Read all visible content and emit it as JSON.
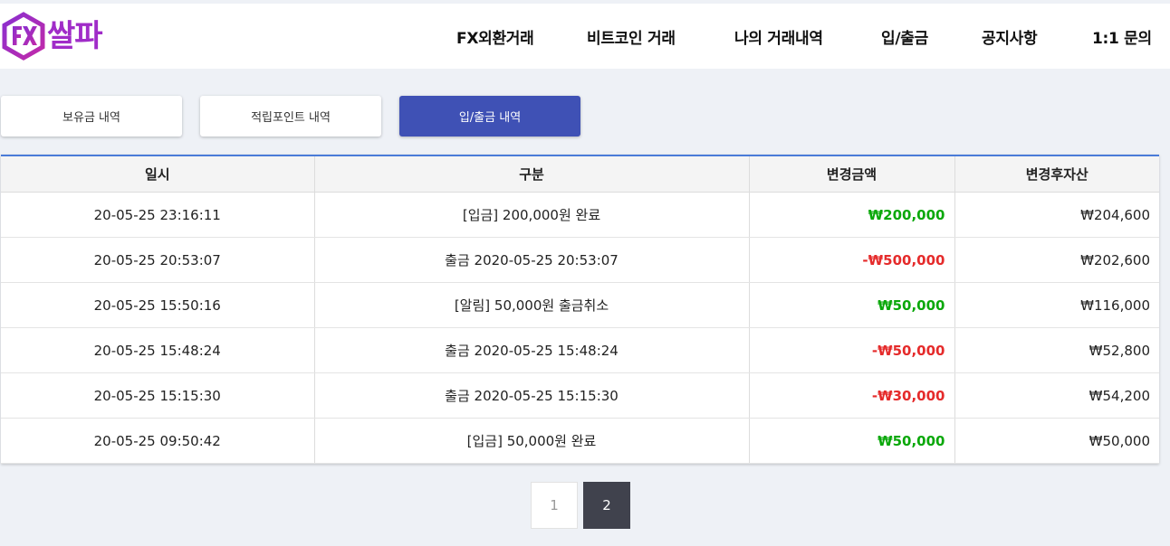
{
  "brand": {
    "logo_text": "쌀파",
    "accent": "#a02cc8"
  },
  "nav": [
    {
      "id": "fx",
      "label": "FX외환거래"
    },
    {
      "id": "bitcoin",
      "label": "비트코인 거래"
    },
    {
      "id": "history",
      "label": "나의 거래내역"
    },
    {
      "id": "deposit",
      "label": "입/출금"
    },
    {
      "id": "notice",
      "label": "공지사항"
    },
    {
      "id": "inquiry",
      "label": "1:1 문의"
    }
  ],
  "tabs": [
    {
      "label": "보유금 내역",
      "active": false
    },
    {
      "label": "적립포인트 내역",
      "active": false
    },
    {
      "label": "입/출금 내역",
      "active": true
    }
  ],
  "table": {
    "headers": [
      "일시",
      "구분",
      "변경금액",
      "변경후자산"
    ],
    "rows": [
      {
        "date": "20-05-25 23:16:11",
        "desc": "[입금] 200,000원 완료",
        "change": "₩200,000",
        "sign": "pos",
        "balance": "₩204,600"
      },
      {
        "date": "20-05-25 20:53:07",
        "desc": "출금 2020-05-25 20:53:07",
        "change": "-₩500,000",
        "sign": "neg",
        "balance": "₩202,600"
      },
      {
        "date": "20-05-25 15:50:16",
        "desc": "[알림] 50,000원 출금취소",
        "change": "₩50,000",
        "sign": "pos",
        "balance": "₩116,000"
      },
      {
        "date": "20-05-25 15:48:24",
        "desc": "출금 2020-05-25 15:48:24",
        "change": "-₩50,000",
        "sign": "neg",
        "balance": "₩52,800"
      },
      {
        "date": "20-05-25 15:15:30",
        "desc": "출금 2020-05-25 15:15:30",
        "change": "-₩30,000",
        "sign": "neg",
        "balance": "₩54,200"
      },
      {
        "date": "20-05-25 09:50:42",
        "desc": "[입금] 50,000원 완료",
        "change": "₩50,000",
        "sign": "pos",
        "balance": "₩50,000"
      }
    ]
  },
  "pagination": {
    "pages": [
      "1",
      "2"
    ],
    "current": "2"
  },
  "colors": {
    "active_tab": "#3f51b5",
    "positive": "#0aa80a",
    "negative": "#e52b2b",
    "table_accent": "#4a7bd8"
  }
}
